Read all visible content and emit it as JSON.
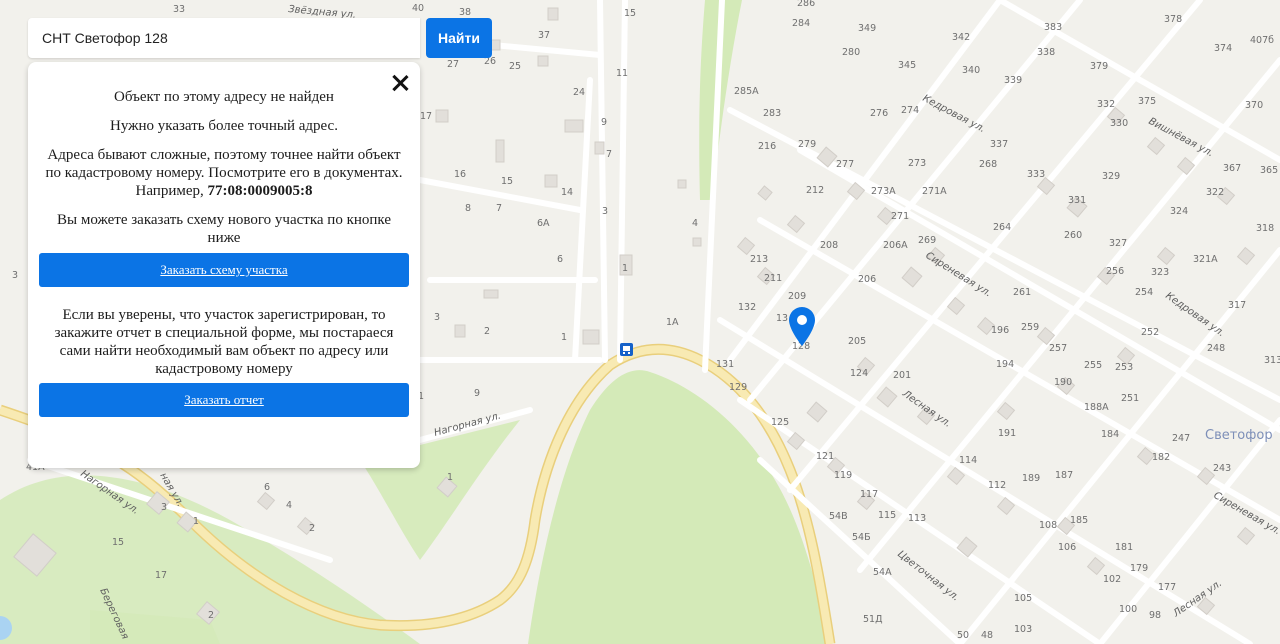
{
  "search": {
    "value": "СНТ Светофор 128",
    "button_label": "Найти"
  },
  "panel": {
    "title": "Объект по этому адресу не найден",
    "need_precise": "Нужно указать более точный адрес.",
    "cadastral_text": "Адреса бывают сложные, поэтому точнее найти объект по кадастровому номеру. Посмотрите его в документах. Например, ",
    "cadastral_example": "77:08:0009005:8",
    "order_scheme_text": "Вы можете заказать схему нового участка по кнопке ниже",
    "order_scheme_button": "Заказать схему участка",
    "report_text": "Если вы уверены, что участок зарегистрирован, то закажите отчет в специальной форме, мы постараеся сами найти необходимый вам объект по адресу или кадастровому номеру",
    "order_report_button": "Заказать отчет"
  },
  "map": {
    "streets": [
      "Звёздная ул.",
      "Нагорная ул.",
      "Кедровая ул.",
      "Вишнёвая ул.",
      "Сиреневая ул.",
      "Лесная ул.",
      "Цветочная ул.",
      "Береговая",
      "Сиреневая ул.",
      "Кедровая ул.",
      "Лесная ул."
    ],
    "area_label": "Светофор",
    "bus_stop_icon": "bus-stop-icon",
    "marker_icon": "location-pin-icon",
    "colors": {
      "road": "#f6e6a6",
      "road_edge": "#e9cf7c",
      "forest": "#d4eab8",
      "background": "#f2f1ec",
      "marker": "#0b74e5"
    }
  }
}
